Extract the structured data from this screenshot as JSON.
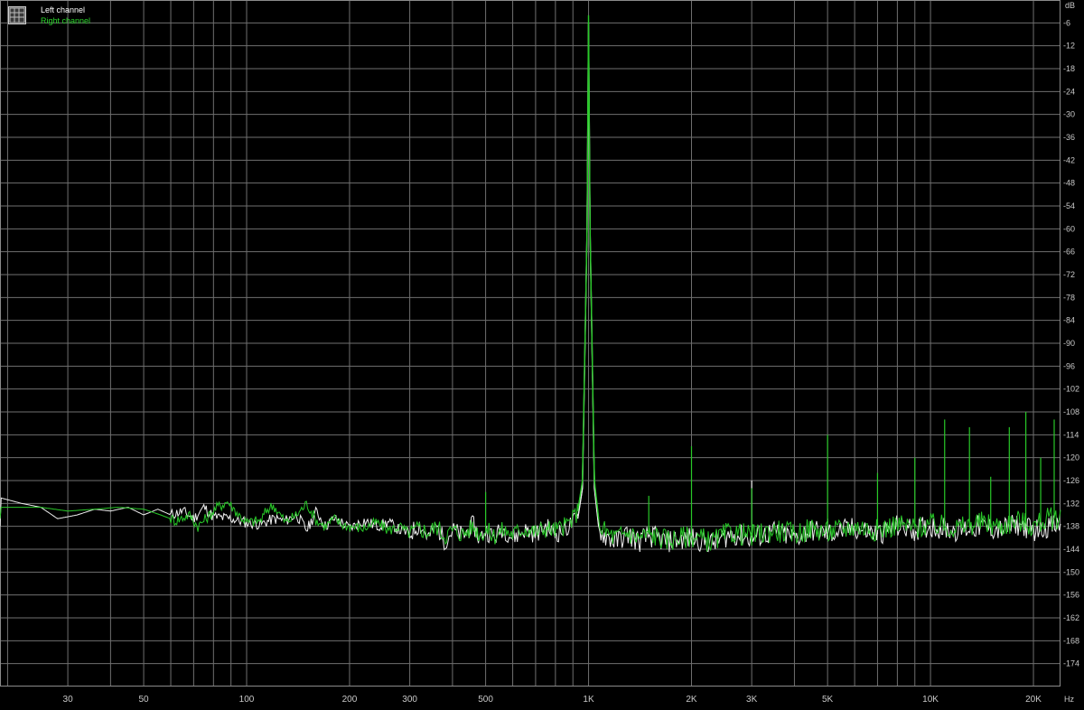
{
  "window": {
    "title": "",
    "background": "#000000",
    "grid_color": "#6f6f6f",
    "axis_text_color": "#c8c8c8"
  },
  "chart_data": {
    "type": "line",
    "title": "",
    "xscale": "log",
    "xunit": "Hz",
    "yunit": "dB",
    "xlim": [
      19,
      24000
    ],
    "ylim": [
      -180,
      0
    ],
    "grid": true,
    "legend_position": "top-left",
    "legend": [
      "Left channel",
      "Right channel"
    ],
    "x_tick_labels": [
      {
        "value": 30,
        "label": "30"
      },
      {
        "value": 50,
        "label": "50"
      },
      {
        "value": 100,
        "label": "100"
      },
      {
        "value": 200,
        "label": "200"
      },
      {
        "value": 300,
        "label": "300"
      },
      {
        "value": 500,
        "label": "500"
      },
      {
        "value": 1000,
        "label": "1K"
      },
      {
        "value": 2000,
        "label": "2K"
      },
      {
        "value": 3000,
        "label": "3K"
      },
      {
        "value": 5000,
        "label": "5K"
      },
      {
        "value": 10000,
        "label": "10K"
      },
      {
        "value": 20000,
        "label": "20K"
      }
    ],
    "x_minor_grid": [
      20,
      40,
      60,
      70,
      80,
      90,
      400,
      600,
      700,
      800,
      900,
      4000,
      6000,
      7000,
      8000,
      9000
    ],
    "y_ticks": [
      -6,
      -12,
      -18,
      -24,
      -30,
      -36,
      -42,
      -48,
      -54,
      -60,
      -66,
      -72,
      -78,
      -84,
      -90,
      -96,
      -102,
      -108,
      -114,
      -120,
      -126,
      -132,
      -138,
      -144,
      -150,
      -156,
      -162,
      -168,
      -174
    ],
    "series": [
      {
        "name": "Left channel",
        "color": "#f0f0f0",
        "points": [
          [
            19,
            -130.5
          ],
          [
            22,
            -132
          ],
          [
            25,
            -133
          ],
          [
            28,
            -136
          ],
          [
            32,
            -135
          ],
          [
            36,
            -133.5
          ],
          [
            40,
            -134
          ],
          [
            45,
            -133
          ],
          [
            50,
            -135
          ],
          [
            55,
            -133.5
          ],
          [
            60,
            -135
          ],
          [
            65,
            -134
          ],
          [
            70,
            -136
          ],
          [
            75,
            -133
          ],
          [
            80,
            -135.5
          ],
          [
            90,
            -136
          ],
          [
            100,
            -137
          ],
          [
            110,
            -137.5
          ],
          [
            120,
            -136
          ],
          [
            130,
            -136.5
          ],
          [
            140,
            -135
          ],
          [
            150,
            -139
          ],
          [
            160,
            -134
          ],
          [
            170,
            -138
          ],
          [
            180,
            -136
          ],
          [
            190,
            -137
          ],
          [
            200,
            -138.5
          ],
          [
            220,
            -136.5
          ],
          [
            240,
            -138
          ],
          [
            260,
            -137
          ],
          [
            280,
            -139
          ],
          [
            300,
            -140
          ],
          [
            320,
            -137.5
          ],
          [
            340,
            -141
          ],
          [
            360,
            -138
          ],
          [
            380,
            -142
          ],
          [
            400,
            -139
          ],
          [
            430,
            -140.5
          ],
          [
            460,
            -137.5
          ],
          [
            480,
            -141.5
          ],
          [
            500,
            -139
          ],
          [
            530,
            -141
          ],
          [
            560,
            -138.5
          ],
          [
            600,
            -141
          ],
          [
            650,
            -139
          ],
          [
            700,
            -140
          ],
          [
            750,
            -138
          ],
          [
            800,
            -140
          ],
          [
            850,
            -139
          ],
          [
            900,
            -137
          ],
          [
            930,
            -136
          ],
          [
            960,
            -128
          ],
          [
            990,
            -60
          ],
          [
            1000,
            -6
          ],
          [
            1010,
            -60
          ],
          [
            1040,
            -128
          ],
          [
            1070,
            -138
          ],
          [
            1100,
            -140
          ],
          [
            1200,
            -142
          ],
          [
            1300,
            -140
          ],
          [
            1400,
            -142
          ],
          [
            1500,
            -140.5
          ],
          [
            1700,
            -142
          ],
          [
            2000,
            -141
          ],
          [
            2300,
            -142.5
          ],
          [
            2600,
            -140
          ],
          [
            3000,
            -141
          ],
          [
            3500,
            -139.5
          ],
          [
            4000,
            -141
          ],
          [
            4500,
            -139
          ],
          [
            5000,
            -140
          ],
          [
            6000,
            -138.5
          ],
          [
            7000,
            -140
          ],
          [
            8000,
            -138
          ],
          [
            9000,
            -139
          ],
          [
            10000,
            -138
          ],
          [
            12000,
            -139
          ],
          [
            14000,
            -138
          ],
          [
            16000,
            -139
          ],
          [
            18000,
            -137.5
          ],
          [
            20000,
            -139
          ],
          [
            22000,
            -138
          ],
          [
            24000,
            -138
          ]
        ],
        "spikes": [
          [
            2000,
            -138
          ],
          [
            3000,
            -126
          ],
          [
            5000,
            -136
          ],
          [
            7000,
            -137
          ]
        ]
      },
      {
        "name": "Right channel",
        "color": "#28c828",
        "points": [
          [
            19,
            -133
          ],
          [
            25,
            -133
          ],
          [
            30,
            -134
          ],
          [
            36,
            -133.5
          ],
          [
            42,
            -133
          ],
          [
            50,
            -133.5
          ],
          [
            56,
            -135
          ],
          [
            62,
            -136.5
          ],
          [
            68,
            -135
          ],
          [
            72,
            -138
          ],
          [
            76,
            -136
          ],
          [
            82,
            -133
          ],
          [
            88,
            -131.5
          ],
          [
            95,
            -135
          ],
          [
            100,
            -137
          ],
          [
            110,
            -136.5
          ],
          [
            115,
            -133.5
          ],
          [
            120,
            -132.5
          ],
          [
            130,
            -137
          ],
          [
            140,
            -135
          ],
          [
            150,
            -132
          ],
          [
            160,
            -136.5
          ],
          [
            170,
            -138
          ],
          [
            180,
            -136
          ],
          [
            190,
            -137.5
          ],
          [
            200,
            -138
          ],
          [
            220,
            -138.5
          ],
          [
            240,
            -137
          ],
          [
            260,
            -139
          ],
          [
            280,
            -138
          ],
          [
            300,
            -140
          ],
          [
            320,
            -138.5
          ],
          [
            340,
            -139.5
          ],
          [
            360,
            -138
          ],
          [
            380,
            -140.5
          ],
          [
            400,
            -139
          ],
          [
            430,
            -140
          ],
          [
            460,
            -138
          ],
          [
            480,
            -140
          ],
          [
            500,
            -139
          ],
          [
            530,
            -140.5
          ],
          [
            560,
            -139
          ],
          [
            600,
            -140
          ],
          [
            650,
            -138.5
          ],
          [
            700,
            -139.5
          ],
          [
            750,
            -138.5
          ],
          [
            800,
            -139
          ],
          [
            850,
            -138
          ],
          [
            900,
            -136
          ],
          [
            930,
            -134
          ],
          [
            960,
            -126
          ],
          [
            990,
            -60
          ],
          [
            1000,
            -4
          ],
          [
            1010,
            -60
          ],
          [
            1040,
            -126
          ],
          [
            1070,
            -136
          ],
          [
            1100,
            -139
          ],
          [
            1200,
            -141
          ],
          [
            1300,
            -139.5
          ],
          [
            1400,
            -141
          ],
          [
            1500,
            -140
          ],
          [
            1700,
            -141.5
          ],
          [
            2000,
            -140.5
          ],
          [
            2300,
            -142
          ],
          [
            2600,
            -139.5
          ],
          [
            3000,
            -140.5
          ],
          [
            3500,
            -139
          ],
          [
            4000,
            -140
          ],
          [
            4500,
            -138.5
          ],
          [
            5000,
            -139.5
          ],
          [
            6000,
            -138
          ],
          [
            7000,
            -139
          ],
          [
            8000,
            -137.5
          ],
          [
            9000,
            -138.5
          ],
          [
            10000,
            -137.5
          ],
          [
            12000,
            -138.5
          ],
          [
            14000,
            -137
          ],
          [
            16000,
            -138
          ],
          [
            18000,
            -136.5
          ],
          [
            20000,
            -138
          ],
          [
            22000,
            -136
          ],
          [
            24000,
            -136
          ]
        ],
        "spikes": [
          [
            500,
            -129
          ],
          [
            1500,
            -130
          ],
          [
            2000,
            -117
          ],
          [
            3000,
            -128
          ],
          [
            5000,
            -114
          ],
          [
            7000,
            -124
          ],
          [
            9000,
            -120
          ],
          [
            11000,
            -110
          ],
          [
            13000,
            -112
          ],
          [
            15000,
            -125
          ],
          [
            17000,
            -112
          ],
          [
            19000,
            -108
          ],
          [
            21000,
            -120
          ],
          [
            23000,
            -110
          ]
        ]
      }
    ]
  }
}
